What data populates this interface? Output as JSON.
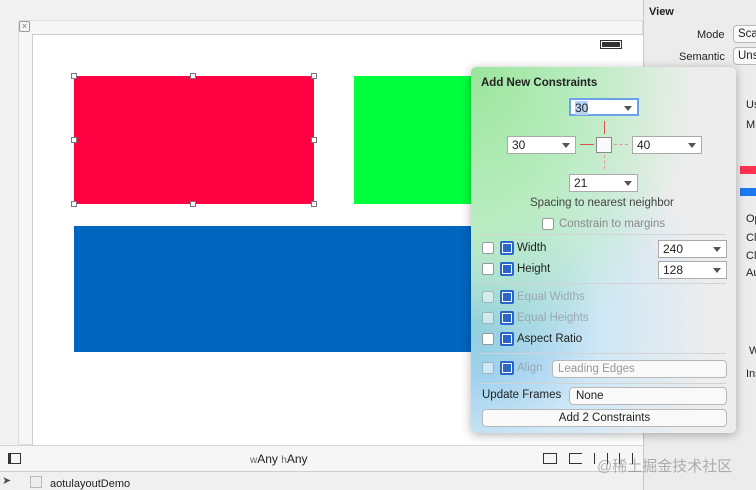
{
  "canvas": {
    "red_color": "#ff0040",
    "green_color": "#00ff3c",
    "blue_color": "#0066c0"
  },
  "inspector": {
    "section": "View",
    "mode_label": "Mode",
    "mode_value": "Sca",
    "semantic_label": "Semantic",
    "semantic_value": "Uns",
    "rows": [
      "Us",
      "M",
      "Op",
      "Cl",
      "Cl",
      "Au",
      "W",
      "Ins"
    ]
  },
  "popover": {
    "title": "Add New Constraints",
    "top": "30",
    "left": "30",
    "right": "40",
    "bottom": "21",
    "spacing_label": "Spacing to nearest neighbor",
    "margins_label": "Constrain to margins",
    "width_label": "Width",
    "width_value": "240",
    "height_label": "Height",
    "height_value": "128",
    "equal_widths": "Equal Widths",
    "equal_heights": "Equal Heights",
    "aspect_ratio": "Aspect Ratio",
    "align_label": "Align",
    "align_value": "Leading Edges",
    "update_label": "Update Frames",
    "update_value": "None",
    "add_button": "Add 2 Constraints"
  },
  "bottom": {
    "w_prefix": "w",
    "w_value": "Any",
    "h_prefix": "h",
    "h_value": "Any"
  },
  "status": {
    "project": "aotulayoutDemo",
    "watermark": "@稀土掘金技术社区"
  }
}
